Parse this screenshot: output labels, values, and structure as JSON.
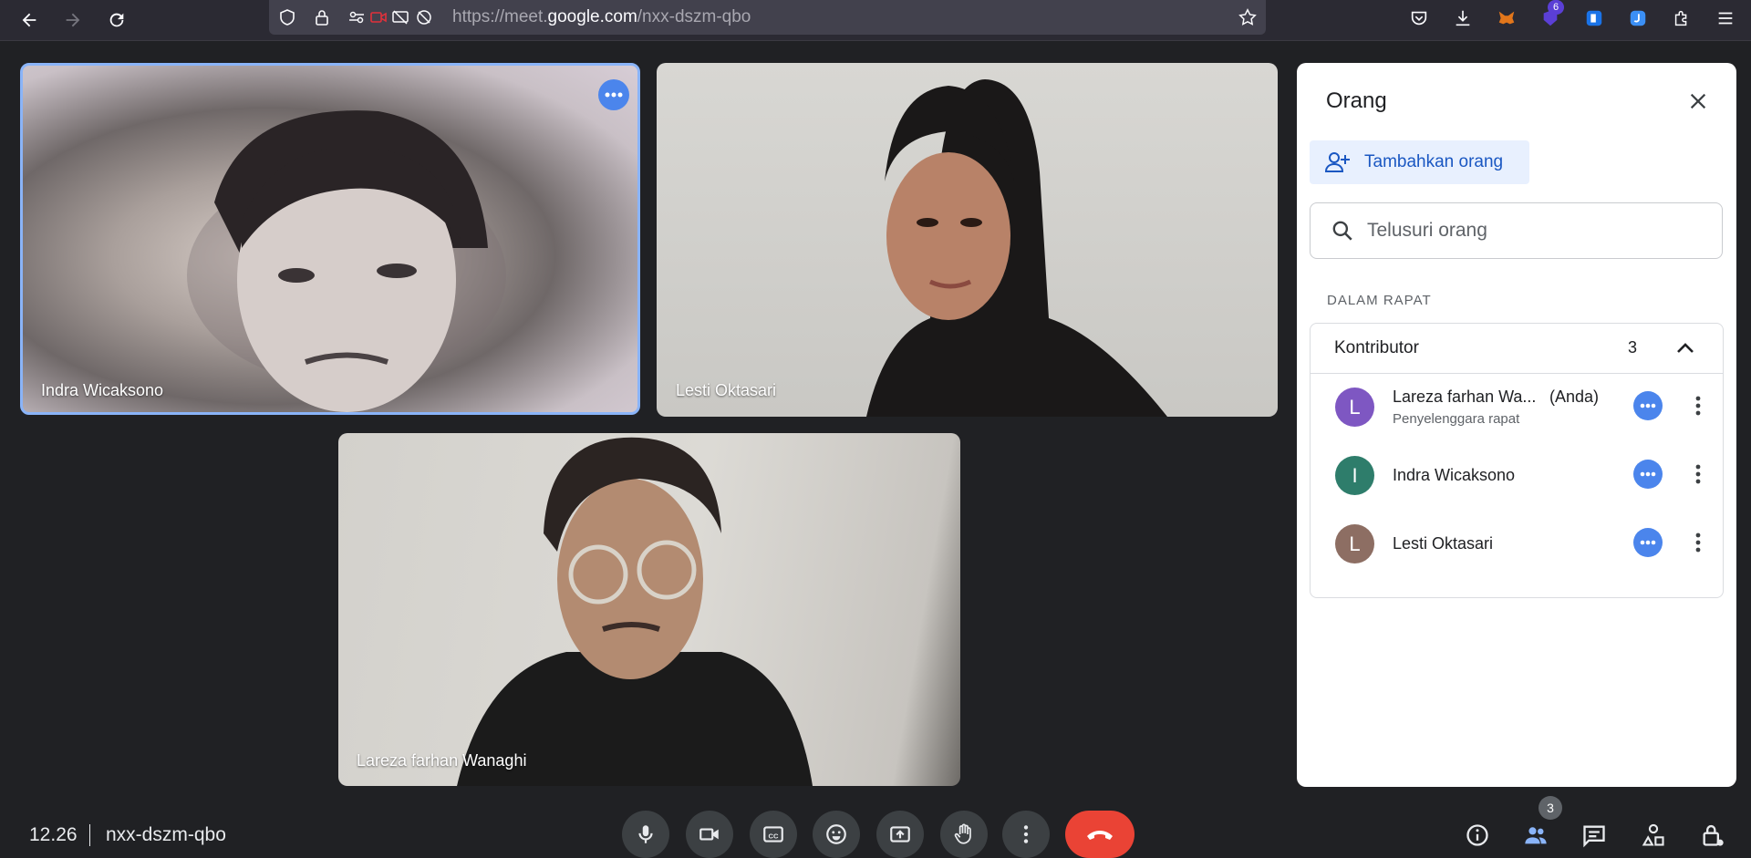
{
  "browser": {
    "url_prefix": "https://meet.",
    "url_domain": "google.com",
    "url_path": "/nxx-dszm-qbo",
    "extension_badge": "6"
  },
  "tiles": [
    {
      "name": "Indra Wicaksono",
      "active": true
    },
    {
      "name": "Lesti Oktasari",
      "active": false
    },
    {
      "name": "Lareza farhan Wanaghi",
      "active": false
    }
  ],
  "panel": {
    "title": "Orang",
    "add_label": "Tambahkan orang",
    "search_placeholder": "Telusuri orang",
    "section_label": "DALAM RAPAT",
    "group_title": "Kontributor",
    "group_count": "3",
    "people": [
      {
        "initial": "L",
        "name": "Lareza farhan Wa...",
        "tag": "(Anda)",
        "role": "Penyelenggara rapat",
        "color": "#7e57c2"
      },
      {
        "initial": "I",
        "name": "Indra Wicaksono",
        "tag": "",
        "role": "",
        "color": "#2e7d6b"
      },
      {
        "initial": "L",
        "name": "Lesti Oktasari",
        "tag": "",
        "role": "",
        "color": "#8d6e63"
      }
    ]
  },
  "bottom": {
    "time": "12.26",
    "meeting_code": "nxx-dszm-qbo",
    "participant_count": "3"
  },
  "colors": {
    "accent": "#4b85ec",
    "end_call": "#ea4335",
    "background": "#202124"
  }
}
